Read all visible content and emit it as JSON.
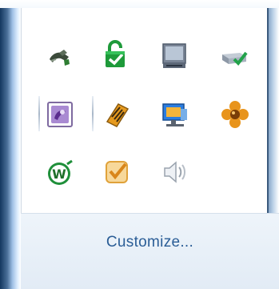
{
  "tray": {
    "icons": [
      {
        "name": "network-cable-icon"
      },
      {
        "name": "green-lock-update-icon"
      },
      {
        "name": "display-monitor-icon"
      },
      {
        "name": "network-adapter-check-icon"
      },
      {
        "name": "purple-app-icon"
      },
      {
        "name": "orange-notepad-icon"
      },
      {
        "name": "blue-projector-icon"
      },
      {
        "name": "orange-flower-icon"
      },
      {
        "name": "green-w-icon"
      },
      {
        "name": "orange-checkbox-icon"
      },
      {
        "name": "speaker-volume-icon"
      }
    ]
  },
  "footer": {
    "customize_label": "Customize..."
  },
  "colors": {
    "link": "#2a5d96",
    "frame_dark": "#13375f",
    "band": "#e8f0f8"
  }
}
